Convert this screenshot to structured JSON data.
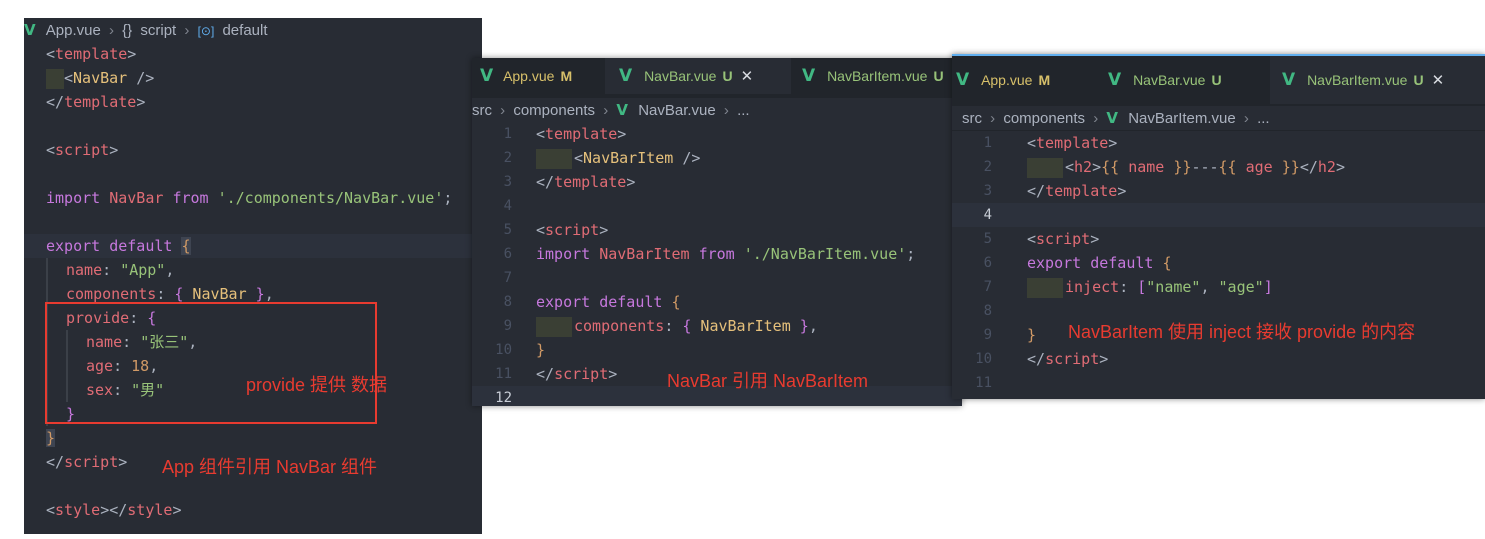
{
  "colors": {
    "accent": "#61afef",
    "vue": "#41b883",
    "annotation": "#e83b30"
  },
  "panel_app": {
    "breadcrumb": {
      "file": "App.vue",
      "section": "script",
      "item": "default",
      "braces_icon": "{}",
      "symbol_icon": "[⊙]"
    },
    "lines": {
      "l1a": "<",
      "l1b": "template",
      "l1c": ">",
      "l2a": "<",
      "l2b": "NavBar",
      "l2c": " />",
      "l3a": "</",
      "l3b": "template",
      "l3c": ">",
      "l5a": "<",
      "l5b": "script",
      "l5c": ">",
      "l7a": "import",
      "l7b": " NavBar ",
      "l7c": "from",
      "l7d": " ",
      "l7e": "'./components/NavBar.vue'",
      "l7f": ";",
      "l9a": "export",
      "l9b": " ",
      "l9c": "default",
      "l9d": " ",
      "l9e": "{",
      "l10a": "name",
      "l10b": ": ",
      "l10c": "\"App\"",
      "l10d": ",",
      "l11a": "components",
      "l11b": ": ",
      "l11c": "{",
      "l11d": " NavBar ",
      "l11e": "}",
      "l11f": ",",
      "l12a": "provide",
      "l12b": ": ",
      "l12c": "{",
      "l13a": "name",
      "l13b": ": ",
      "l13c": "\"张三\"",
      "l13d": ",",
      "l14a": "age",
      "l14b": ": ",
      "l14c": "18",
      "l14d": ",",
      "l15a": "sex",
      "l15b": ": ",
      "l15c": "\"男\"",
      "l16a": "}",
      "l17a": "}",
      "l18a": "</",
      "l18b": "script",
      "l18c": ">",
      "l20a": "<",
      "l20b": "style",
      "l20c": "></",
      "l20d": "style",
      "l20e": ">"
    },
    "notes": {
      "provide": "provide 提供 数据",
      "app": "App 组件引用 NavBar 组件"
    }
  },
  "panel_navbar": {
    "tabs": [
      {
        "icon": "V",
        "label": "App.vue",
        "status": "M"
      },
      {
        "icon": "V",
        "label": "NavBar.vue",
        "status": "U",
        "close": "✕"
      },
      {
        "icon": "V",
        "label": "NavBarItem.vue",
        "status": "U"
      }
    ],
    "breadcrumb": {
      "p1": "src",
      "p2": "components",
      "file": "NavBar.vue",
      "more": "..."
    },
    "line_numbers": [
      "1",
      "2",
      "3",
      "4",
      "5",
      "6",
      "7",
      "8",
      "9",
      "10",
      "11",
      "12"
    ],
    "lines": {
      "l1a": "<",
      "l1b": "template",
      "l1c": ">",
      "l2a": "<",
      "l2b": "NavBarItem",
      "l2c": " />",
      "l3a": "</",
      "l3b": "template",
      "l3c": ">",
      "l5a": "<",
      "l5b": "script",
      "l5c": ">",
      "l6a": "import",
      "l6b": " NavBarItem ",
      "l6c": "from",
      "l6d": " ",
      "l6e": "'./NavBarItem.vue'",
      "l6f": ";",
      "l8a": "export",
      "l8b": " ",
      "l8c": "default",
      "l8d": " ",
      "l8e": "{",
      "l9a": "components",
      "l9b": ": ",
      "l9c": "{",
      "l9d": " NavBarItem ",
      "l9e": "}",
      "l9f": ",",
      "l10a": "}",
      "l11a": "</",
      "l11b": "script",
      "l11c": ">"
    },
    "note": "NavBar 引用 NavBarItem"
  },
  "panel_navbaritem": {
    "tabs": [
      {
        "icon": "V",
        "label": "App.vue",
        "status": "M"
      },
      {
        "icon": "V",
        "label": "NavBar.vue",
        "status": "U"
      },
      {
        "icon": "V",
        "label": "NavBarItem.vue",
        "status": "U",
        "close": "✕"
      }
    ],
    "breadcrumb": {
      "p1": "src",
      "p2": "components",
      "file": "NavBarItem.vue",
      "more": "..."
    },
    "line_numbers": [
      "1",
      "2",
      "3",
      "4",
      "5",
      "6",
      "7",
      "8",
      "9",
      "10",
      "11"
    ],
    "lines": {
      "l1a": "<",
      "l1b": "template",
      "l1c": ">",
      "l2a": "<",
      "l2b": "h2",
      "l2c": ">",
      "l2d": "{{",
      "l2e": " name ",
      "l2f": "}}",
      "l2g": "---",
      "l2h": "{{",
      "l2i": " age ",
      "l2j": "}}",
      "l2k": "</",
      "l2l": "h2",
      "l2m": ">",
      "l3a": "</",
      "l3b": "template",
      "l3c": ">",
      "l5a": "<",
      "l5b": "script",
      "l5c": ">",
      "l6a": "export",
      "l6b": " ",
      "l6c": "default",
      "l6d": " ",
      "l6e": "{",
      "l7a": "inject",
      "l7b": ": ",
      "l7c": "[",
      "l7d": "\"name\"",
      "l7e": ", ",
      "l7f": "\"age\"",
      "l7g": "]",
      "l9a": "}",
      "l10a": "</",
      "l10b": "script",
      "l10c": ">"
    },
    "note": "NavBarItem 使用 inject 接收 provide 的内容"
  }
}
